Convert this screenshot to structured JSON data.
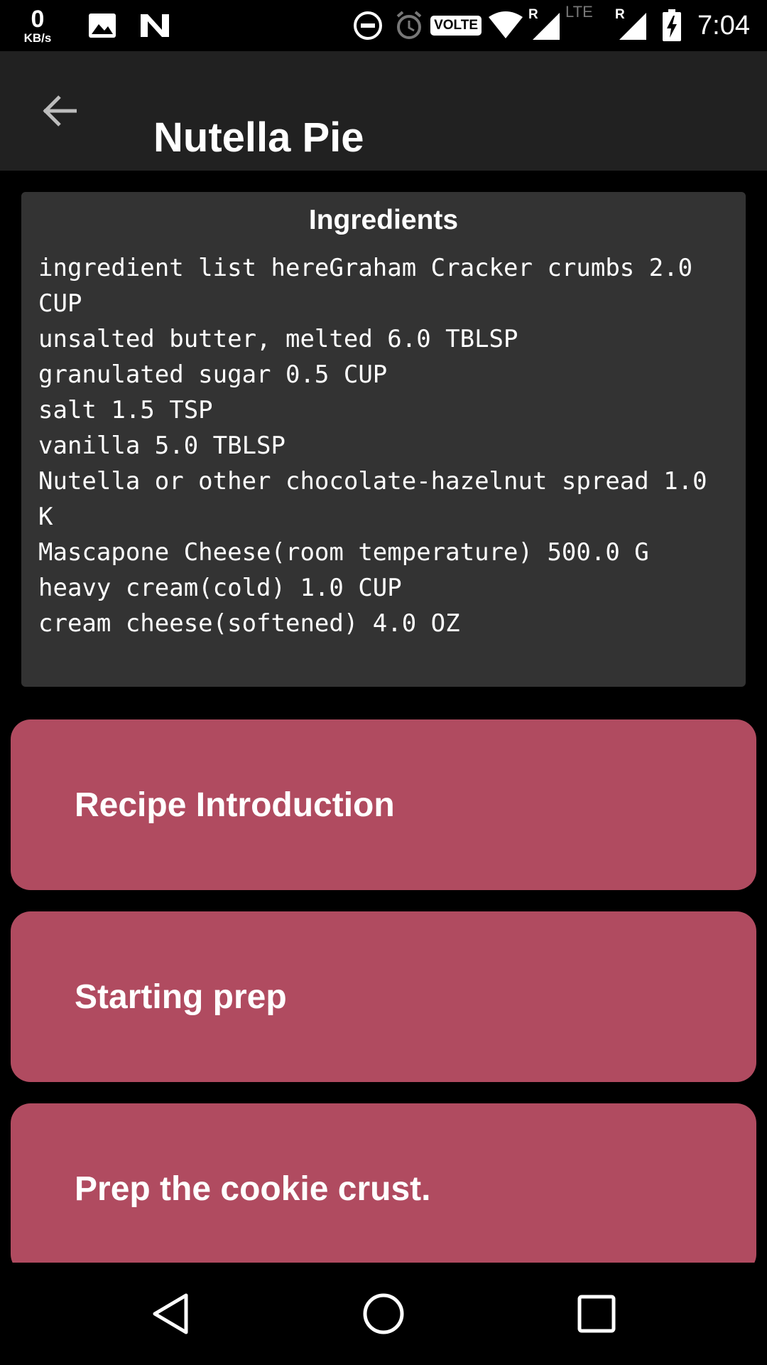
{
  "status_bar": {
    "net_speed_value": "0",
    "net_speed_unit": "KB/s",
    "volte_label": "VOLTE",
    "roaming_1": "R",
    "lte_label": "LTE",
    "roaming_2": "R",
    "time": "7:04",
    "icons": [
      "image-icon",
      "n-notification-icon",
      "dnd-icon",
      "alarm-icon",
      "volte-badge",
      "wifi-icon",
      "signal-icon",
      "lte-signal-icon",
      "battery-charging-icon"
    ]
  },
  "app_bar": {
    "title": "Nutella Pie",
    "back_icon": "arrow-back-icon"
  },
  "ingredients": {
    "heading": "Ingredients",
    "text": "ingredient list hereGraham Cracker crumbs 2.0 CUP\nunsalted butter, melted 6.0 TBLSP\ngranulated sugar 0.5 CUP\nsalt 1.5 TSP\nvanilla 5.0 TBLSP\nNutella or other chocolate-hazelnut spread 1.0 K\nMascapone Cheese(room temperature) 500.0 G\nheavy cream(cold) 1.0 CUP\ncream cheese(softened) 4.0 OZ"
  },
  "steps": [
    {
      "label": "Recipe Introduction"
    },
    {
      "label": "Starting prep"
    },
    {
      "label": "Prep the cookie crust."
    }
  ],
  "nav_bar": {
    "icons": [
      "back-triangle-icon",
      "home-circle-icon",
      "recents-square-icon"
    ]
  },
  "colors": {
    "app_bar_bg": "#212121",
    "card_bg": "#333333",
    "step_card_bg": "#b04b60",
    "background": "#000000"
  }
}
